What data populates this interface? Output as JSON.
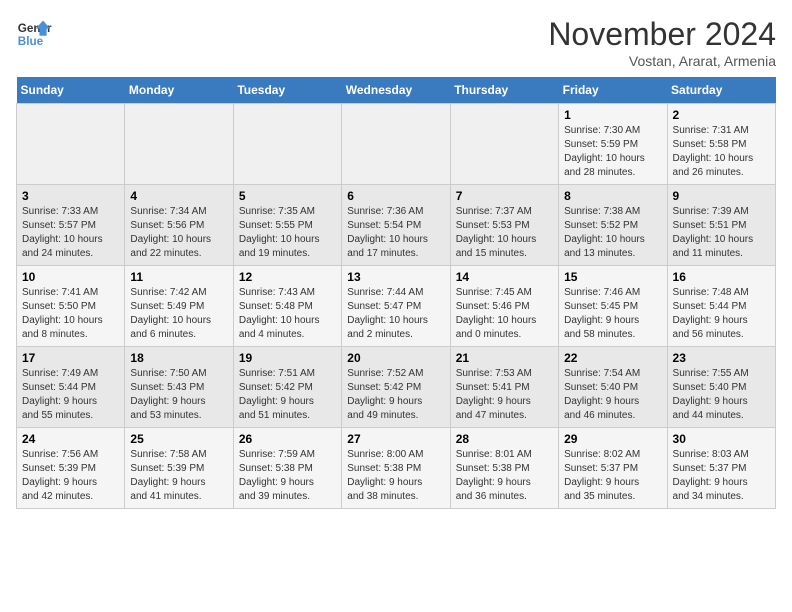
{
  "logo": {
    "line1": "General",
    "line2": "Blue"
  },
  "title": "November 2024",
  "subtitle": "Vostan, Ararat, Armenia",
  "weekdays": [
    "Sunday",
    "Monday",
    "Tuesday",
    "Wednesday",
    "Thursday",
    "Friday",
    "Saturday"
  ],
  "weeks": [
    [
      {
        "day": "",
        "info": ""
      },
      {
        "day": "",
        "info": ""
      },
      {
        "day": "",
        "info": ""
      },
      {
        "day": "",
        "info": ""
      },
      {
        "day": "",
        "info": ""
      },
      {
        "day": "1",
        "info": "Sunrise: 7:30 AM\nSunset: 5:59 PM\nDaylight: 10 hours\nand 28 minutes."
      },
      {
        "day": "2",
        "info": "Sunrise: 7:31 AM\nSunset: 5:58 PM\nDaylight: 10 hours\nand 26 minutes."
      }
    ],
    [
      {
        "day": "3",
        "info": "Sunrise: 7:33 AM\nSunset: 5:57 PM\nDaylight: 10 hours\nand 24 minutes."
      },
      {
        "day": "4",
        "info": "Sunrise: 7:34 AM\nSunset: 5:56 PM\nDaylight: 10 hours\nand 22 minutes."
      },
      {
        "day": "5",
        "info": "Sunrise: 7:35 AM\nSunset: 5:55 PM\nDaylight: 10 hours\nand 19 minutes."
      },
      {
        "day": "6",
        "info": "Sunrise: 7:36 AM\nSunset: 5:54 PM\nDaylight: 10 hours\nand 17 minutes."
      },
      {
        "day": "7",
        "info": "Sunrise: 7:37 AM\nSunset: 5:53 PM\nDaylight: 10 hours\nand 15 minutes."
      },
      {
        "day": "8",
        "info": "Sunrise: 7:38 AM\nSunset: 5:52 PM\nDaylight: 10 hours\nand 13 minutes."
      },
      {
        "day": "9",
        "info": "Sunrise: 7:39 AM\nSunset: 5:51 PM\nDaylight: 10 hours\nand 11 minutes."
      }
    ],
    [
      {
        "day": "10",
        "info": "Sunrise: 7:41 AM\nSunset: 5:50 PM\nDaylight: 10 hours\nand 8 minutes."
      },
      {
        "day": "11",
        "info": "Sunrise: 7:42 AM\nSunset: 5:49 PM\nDaylight: 10 hours\nand 6 minutes."
      },
      {
        "day": "12",
        "info": "Sunrise: 7:43 AM\nSunset: 5:48 PM\nDaylight: 10 hours\nand 4 minutes."
      },
      {
        "day": "13",
        "info": "Sunrise: 7:44 AM\nSunset: 5:47 PM\nDaylight: 10 hours\nand 2 minutes."
      },
      {
        "day": "14",
        "info": "Sunrise: 7:45 AM\nSunset: 5:46 PM\nDaylight: 10 hours\nand 0 minutes."
      },
      {
        "day": "15",
        "info": "Sunrise: 7:46 AM\nSunset: 5:45 PM\nDaylight: 9 hours\nand 58 minutes."
      },
      {
        "day": "16",
        "info": "Sunrise: 7:48 AM\nSunset: 5:44 PM\nDaylight: 9 hours\nand 56 minutes."
      }
    ],
    [
      {
        "day": "17",
        "info": "Sunrise: 7:49 AM\nSunset: 5:44 PM\nDaylight: 9 hours\nand 55 minutes."
      },
      {
        "day": "18",
        "info": "Sunrise: 7:50 AM\nSunset: 5:43 PM\nDaylight: 9 hours\nand 53 minutes."
      },
      {
        "day": "19",
        "info": "Sunrise: 7:51 AM\nSunset: 5:42 PM\nDaylight: 9 hours\nand 51 minutes."
      },
      {
        "day": "20",
        "info": "Sunrise: 7:52 AM\nSunset: 5:42 PM\nDaylight: 9 hours\nand 49 minutes."
      },
      {
        "day": "21",
        "info": "Sunrise: 7:53 AM\nSunset: 5:41 PM\nDaylight: 9 hours\nand 47 minutes."
      },
      {
        "day": "22",
        "info": "Sunrise: 7:54 AM\nSunset: 5:40 PM\nDaylight: 9 hours\nand 46 minutes."
      },
      {
        "day": "23",
        "info": "Sunrise: 7:55 AM\nSunset: 5:40 PM\nDaylight: 9 hours\nand 44 minutes."
      }
    ],
    [
      {
        "day": "24",
        "info": "Sunrise: 7:56 AM\nSunset: 5:39 PM\nDaylight: 9 hours\nand 42 minutes."
      },
      {
        "day": "25",
        "info": "Sunrise: 7:58 AM\nSunset: 5:39 PM\nDaylight: 9 hours\nand 41 minutes."
      },
      {
        "day": "26",
        "info": "Sunrise: 7:59 AM\nSunset: 5:38 PM\nDaylight: 9 hours\nand 39 minutes."
      },
      {
        "day": "27",
        "info": "Sunrise: 8:00 AM\nSunset: 5:38 PM\nDaylight: 9 hours\nand 38 minutes."
      },
      {
        "day": "28",
        "info": "Sunrise: 8:01 AM\nSunset: 5:38 PM\nDaylight: 9 hours\nand 36 minutes."
      },
      {
        "day": "29",
        "info": "Sunrise: 8:02 AM\nSunset: 5:37 PM\nDaylight: 9 hours\nand 35 minutes."
      },
      {
        "day": "30",
        "info": "Sunrise: 8:03 AM\nSunset: 5:37 PM\nDaylight: 9 hours\nand 34 minutes."
      }
    ]
  ]
}
